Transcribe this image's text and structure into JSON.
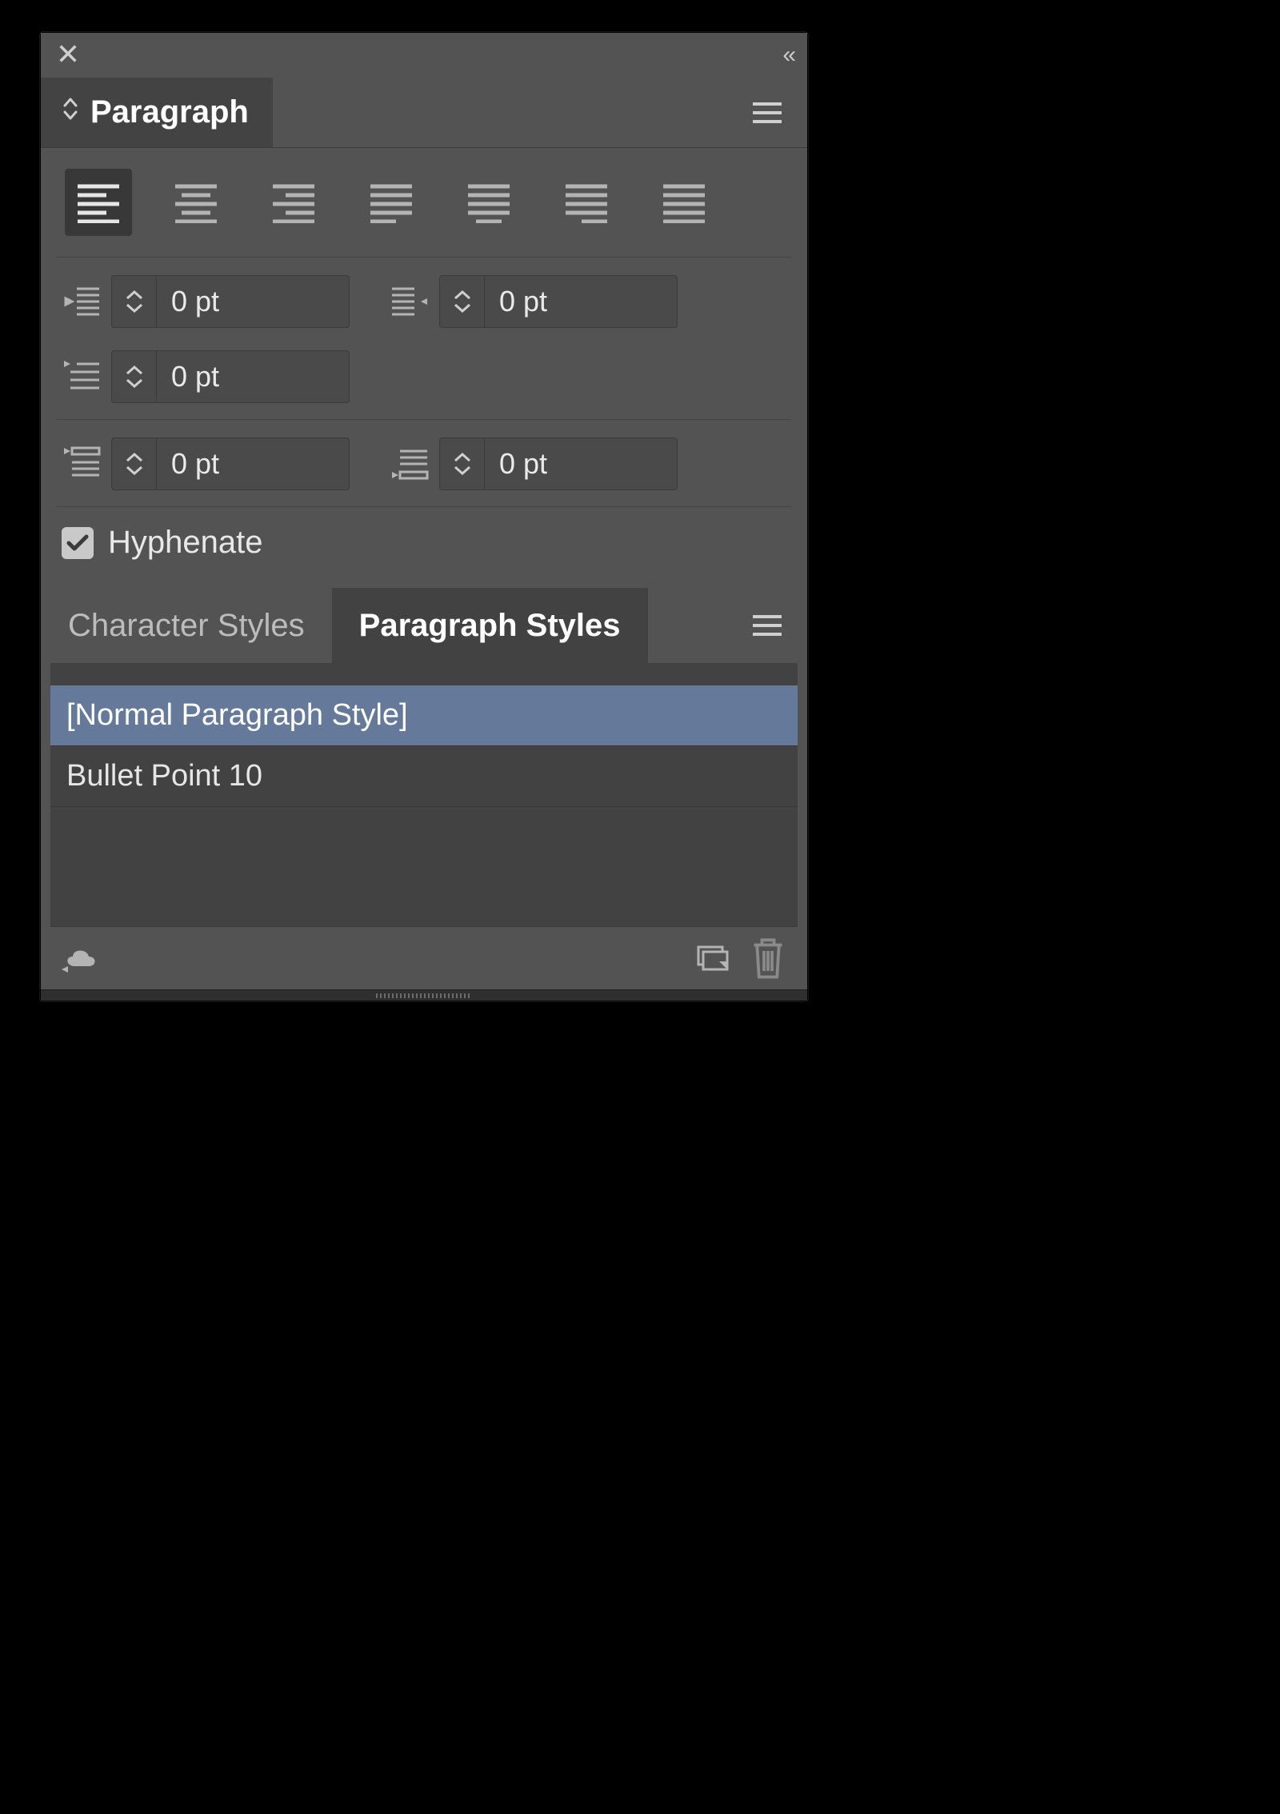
{
  "panel": {
    "tab_label": "Paragraph"
  },
  "alignment": {
    "active_index": 0
  },
  "indents": {
    "left": "0 pt",
    "right": "0 pt",
    "first_line": "0 pt",
    "space_before": "0 pt",
    "space_after": "0 pt"
  },
  "hyphenate": {
    "label": "Hyphenate",
    "checked": true
  },
  "styles": {
    "tabs": {
      "character": "Character Styles",
      "paragraph": "Paragraph Styles"
    },
    "active_tab": "paragraph",
    "items": [
      {
        "label": "[Normal Paragraph Style]",
        "selected": true
      },
      {
        "label": "Bullet Point 10",
        "selected": false
      }
    ]
  }
}
